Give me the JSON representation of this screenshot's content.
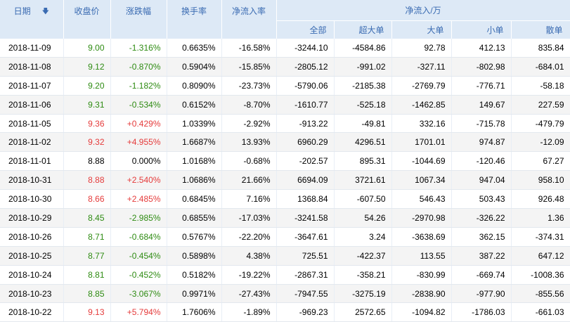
{
  "headers": {
    "date": "日期",
    "close": "收盘价",
    "change_pct": "涨跌幅",
    "turnover": "换手率",
    "net_inflow_ratio": "净流入率",
    "net_inflow_group": "净流入/万",
    "all": "全部",
    "super_large": "超大单",
    "large": "大单",
    "small": "小单",
    "retail": "散单"
  },
  "colors": {
    "up": "#e53b3b",
    "down": "#2e8b12",
    "header_bg": "#dde9f6",
    "header_text": "#3a6bb2"
  },
  "rows": [
    {
      "date": "2018-11-09",
      "close": "9.00",
      "change": "-1.316%",
      "turnover": "0.6635%",
      "ratio": "-16.58%",
      "all": "-3244.10",
      "super": "-4584.86",
      "large": "92.78",
      "small": "412.13",
      "retail": "835.84",
      "dir": "down"
    },
    {
      "date": "2018-11-08",
      "close": "9.12",
      "change": "-0.870%",
      "turnover": "0.5904%",
      "ratio": "-15.85%",
      "all": "-2805.12",
      "super": "-991.02",
      "large": "-327.11",
      "small": "-802.98",
      "retail": "-684.01",
      "dir": "down"
    },
    {
      "date": "2018-11-07",
      "close": "9.20",
      "change": "-1.182%",
      "turnover": "0.8090%",
      "ratio": "-23.73%",
      "all": "-5790.06",
      "super": "-2185.38",
      "large": "-2769.79",
      "small": "-776.71",
      "retail": "-58.18",
      "dir": "down"
    },
    {
      "date": "2018-11-06",
      "close": "9.31",
      "change": "-0.534%",
      "turnover": "0.6152%",
      "ratio": "-8.70%",
      "all": "-1610.77",
      "super": "-525.18",
      "large": "-1462.85",
      "small": "149.67",
      "retail": "227.59",
      "dir": "down"
    },
    {
      "date": "2018-11-05",
      "close": "9.36",
      "change": "+0.429%",
      "turnover": "1.0339%",
      "ratio": "-2.92%",
      "all": "-913.22",
      "super": "-49.81",
      "large": "332.16",
      "small": "-715.78",
      "retail": "-479.79",
      "dir": "up"
    },
    {
      "date": "2018-11-02",
      "close": "9.32",
      "change": "+4.955%",
      "turnover": "1.6687%",
      "ratio": "13.93%",
      "all": "6960.29",
      "super": "4296.51",
      "large": "1701.01",
      "small": "974.87",
      "retail": "-12.09",
      "dir": "up"
    },
    {
      "date": "2018-11-01",
      "close": "8.88",
      "change": "0.000%",
      "turnover": "1.0168%",
      "ratio": "-0.68%",
      "all": "-202.57",
      "super": "895.31",
      "large": "-1044.69",
      "small": "-120.46",
      "retail": "67.27",
      "dir": "flat"
    },
    {
      "date": "2018-10-31",
      "close": "8.88",
      "change": "+2.540%",
      "turnover": "1.0686%",
      "ratio": "21.66%",
      "all": "6694.09",
      "super": "3721.61",
      "large": "1067.34",
      "small": "947.04",
      "retail": "958.10",
      "dir": "up"
    },
    {
      "date": "2018-10-30",
      "close": "8.66",
      "change": "+2.485%",
      "turnover": "0.6845%",
      "ratio": "7.16%",
      "all": "1368.84",
      "super": "-607.50",
      "large": "546.43",
      "small": "503.43",
      "retail": "926.48",
      "dir": "up"
    },
    {
      "date": "2018-10-29",
      "close": "8.45",
      "change": "-2.985%",
      "turnover": "0.6855%",
      "ratio": "-17.03%",
      "all": "-3241.58",
      "super": "54.26",
      "large": "-2970.98",
      "small": "-326.22",
      "retail": "1.36",
      "dir": "down"
    },
    {
      "date": "2018-10-26",
      "close": "8.71",
      "change": "-0.684%",
      "turnover": "0.5767%",
      "ratio": "-22.20%",
      "all": "-3647.61",
      "super": "3.24",
      "large": "-3638.69",
      "small": "362.15",
      "retail": "-374.31",
      "dir": "down"
    },
    {
      "date": "2018-10-25",
      "close": "8.77",
      "change": "-0.454%",
      "turnover": "0.5898%",
      "ratio": "4.38%",
      "all": "725.51",
      "super": "-422.37",
      "large": "113.55",
      "small": "387.22",
      "retail": "647.12",
      "dir": "down"
    },
    {
      "date": "2018-10-24",
      "close": "8.81",
      "change": "-0.452%",
      "turnover": "0.5182%",
      "ratio": "-19.22%",
      "all": "-2867.31",
      "super": "-358.21",
      "large": "-830.99",
      "small": "-669.74",
      "retail": "-1008.36",
      "dir": "down"
    },
    {
      "date": "2018-10-23",
      "close": "8.85",
      "change": "-3.067%",
      "turnover": "0.9971%",
      "ratio": "-27.43%",
      "all": "-7947.55",
      "super": "-3275.19",
      "large": "-2838.90",
      "small": "-977.90",
      "retail": "-855.56",
      "dir": "down"
    },
    {
      "date": "2018-10-22",
      "close": "9.13",
      "change": "+5.794%",
      "turnover": "1.7606%",
      "ratio": "-1.89%",
      "all": "-969.23",
      "super": "2572.65",
      "large": "-1094.82",
      "small": "-1786.03",
      "retail": "-661.03",
      "dir": "up"
    }
  ]
}
